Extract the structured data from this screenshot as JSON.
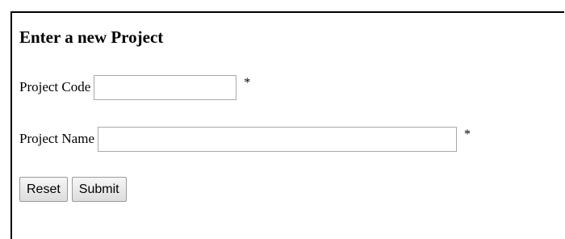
{
  "form": {
    "title": "Enter a new Project",
    "project_code": {
      "label": "Project Code",
      "value": "",
      "required_marker": "*"
    },
    "project_name": {
      "label": "Project Name",
      "value": "",
      "required_marker": "*"
    },
    "buttons": {
      "reset_label": "Reset",
      "submit_label": "Submit"
    }
  }
}
